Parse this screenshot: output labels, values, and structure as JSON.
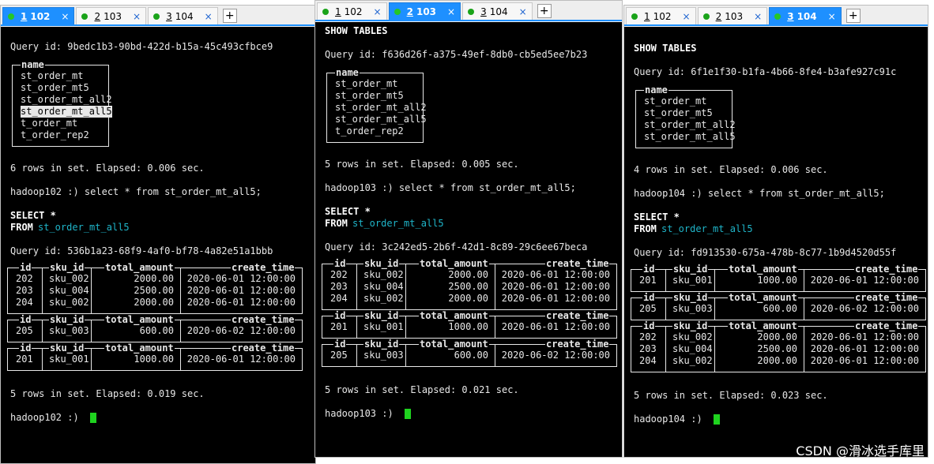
{
  "windows": [
    {
      "tabs": [
        {
          "num": "1",
          "host": "102",
          "active": true
        },
        {
          "num": "2",
          "host": "103",
          "active": false
        },
        {
          "num": "3",
          "host": "104",
          "active": false
        }
      ],
      "lines": {
        "qid1": "Query id: 9bedc1b3-90bd-422d-b15a-45c493cfbce9",
        "rows1": "6 rows in set. Elapsed: 0.006 sec.",
        "cmd": "hadoop102 :) select * from st_order_mt_all5;",
        "select": "SELECT *",
        "from_kw": "FROM",
        "from_tbl": "st_order_mt_all5",
        "qid2": "Query id: 536b1a23-68f9-4af0-bf78-4a82e51a1bbb",
        "rows2": "5 rows in set. Elapsed: 0.019 sec.",
        "prompt": "hadoop102 :)"
      },
      "tables": [
        "st_order_mt",
        "st_order_mt5",
        "st_order_mt_all2",
        "st_order_mt_all5",
        "t_order_mt",
        "t_order_rep2"
      ],
      "result_blocks": [
        [
          [
            "202",
            "sku_002",
            "2000.00",
            "2020-06-01 12:00:00"
          ],
          [
            "203",
            "sku_004",
            "2500.00",
            "2020-06-01 12:00:00"
          ],
          [
            "204",
            "sku_002",
            "2000.00",
            "2020-06-01 12:00:00"
          ]
        ],
        [
          [
            "205",
            "sku_003",
            "600.00",
            "2020-06-02 12:00:00"
          ]
        ],
        [
          [
            "201",
            "sku_001",
            "1000.00",
            "2020-06-01 12:00:00"
          ]
        ]
      ]
    },
    {
      "tabs": [
        {
          "num": "1",
          "host": "102",
          "active": false
        },
        {
          "num": "2",
          "host": "103",
          "active": true
        },
        {
          "num": "3",
          "host": "104",
          "active": false
        }
      ],
      "lines": {
        "show": "SHOW TABLES",
        "qid1": "Query id: f636d26f-a375-49ef-8db0-cb5ed5ee7b23",
        "rows1": "5 rows in set. Elapsed: 0.005 sec.",
        "cmd": "hadoop103 :) select * from st_order_mt_all5;",
        "select": "SELECT *",
        "from_kw": "FROM",
        "from_tbl": "st_order_mt_all5",
        "qid2": "Query id: 3c242ed5-2b6f-42d1-8c89-29c6ee67beca",
        "rows2": "5 rows in set. Elapsed: 0.021 sec.",
        "prompt": "hadoop103 :)"
      },
      "tables": [
        "st_order_mt",
        "st_order_mt5",
        "st_order_mt_all2",
        "st_order_mt_all5",
        "t_order_rep2"
      ],
      "result_blocks": [
        [
          [
            "202",
            "sku_002",
            "2000.00",
            "2020-06-01 12:00:00"
          ],
          [
            "203",
            "sku_004",
            "2500.00",
            "2020-06-01 12:00:00"
          ],
          [
            "204",
            "sku_002",
            "2000.00",
            "2020-06-01 12:00:00"
          ]
        ],
        [
          [
            "201",
            "sku_001",
            "1000.00",
            "2020-06-01 12:00:00"
          ]
        ],
        [
          [
            "205",
            "sku_003",
            "600.00",
            "2020-06-02 12:00:00"
          ]
        ]
      ]
    },
    {
      "tabs": [
        {
          "num": "1",
          "host": "102",
          "active": false
        },
        {
          "num": "2",
          "host": "103",
          "active": false
        },
        {
          "num": "3",
          "host": "104",
          "active": true
        }
      ],
      "lines": {
        "show": "SHOW TABLES",
        "qid1": "Query id: 6f1e1f30-b1fa-4b66-8fe4-b3afe927c91c",
        "rows1": "4 rows in set. Elapsed: 0.006 sec.",
        "cmd": "hadoop104 :) select * from st_order_mt_all5;",
        "select": "SELECT *",
        "from_kw": "FROM",
        "from_tbl": "st_order_mt_all5",
        "qid2": "Query id: fd913530-675a-478b-8c77-1b9d4520d55f",
        "rows2": "5 rows in set. Elapsed: 0.023 sec.",
        "prompt": "hadoop104 :)"
      },
      "tables": [
        "st_order_mt",
        "st_order_mt5",
        "st_order_mt_all2",
        "st_order_mt_all5"
      ],
      "result_blocks": [
        [
          [
            "201",
            "sku_001",
            "1000.00",
            "2020-06-01 12:00:00"
          ]
        ],
        [
          [
            "205",
            "sku_003",
            "600.00",
            "2020-06-02 12:00:00"
          ]
        ],
        [
          [
            "202",
            "sku_002",
            "2000.00",
            "2020-06-01 12:00:00"
          ],
          [
            "203",
            "sku_004",
            "2500.00",
            "2020-06-01 12:00:00"
          ],
          [
            "204",
            "sku_002",
            "2000.00",
            "2020-06-01 12:00:00"
          ]
        ]
      ]
    }
  ],
  "columns": {
    "name_header": "name",
    "id": "id",
    "sku_id": "sku_id",
    "total_amount": "total_amount",
    "create_time": "create_time"
  },
  "plus_label": "+",
  "close_label": "×",
  "watermark": "CSDN @滑冰选手库里",
  "colors": {
    "tab_active": "#1e90ff",
    "status_dot": "#1aa31a",
    "cursor": "#1fd31f",
    "highlight_blue": "#1fb5c9"
  }
}
